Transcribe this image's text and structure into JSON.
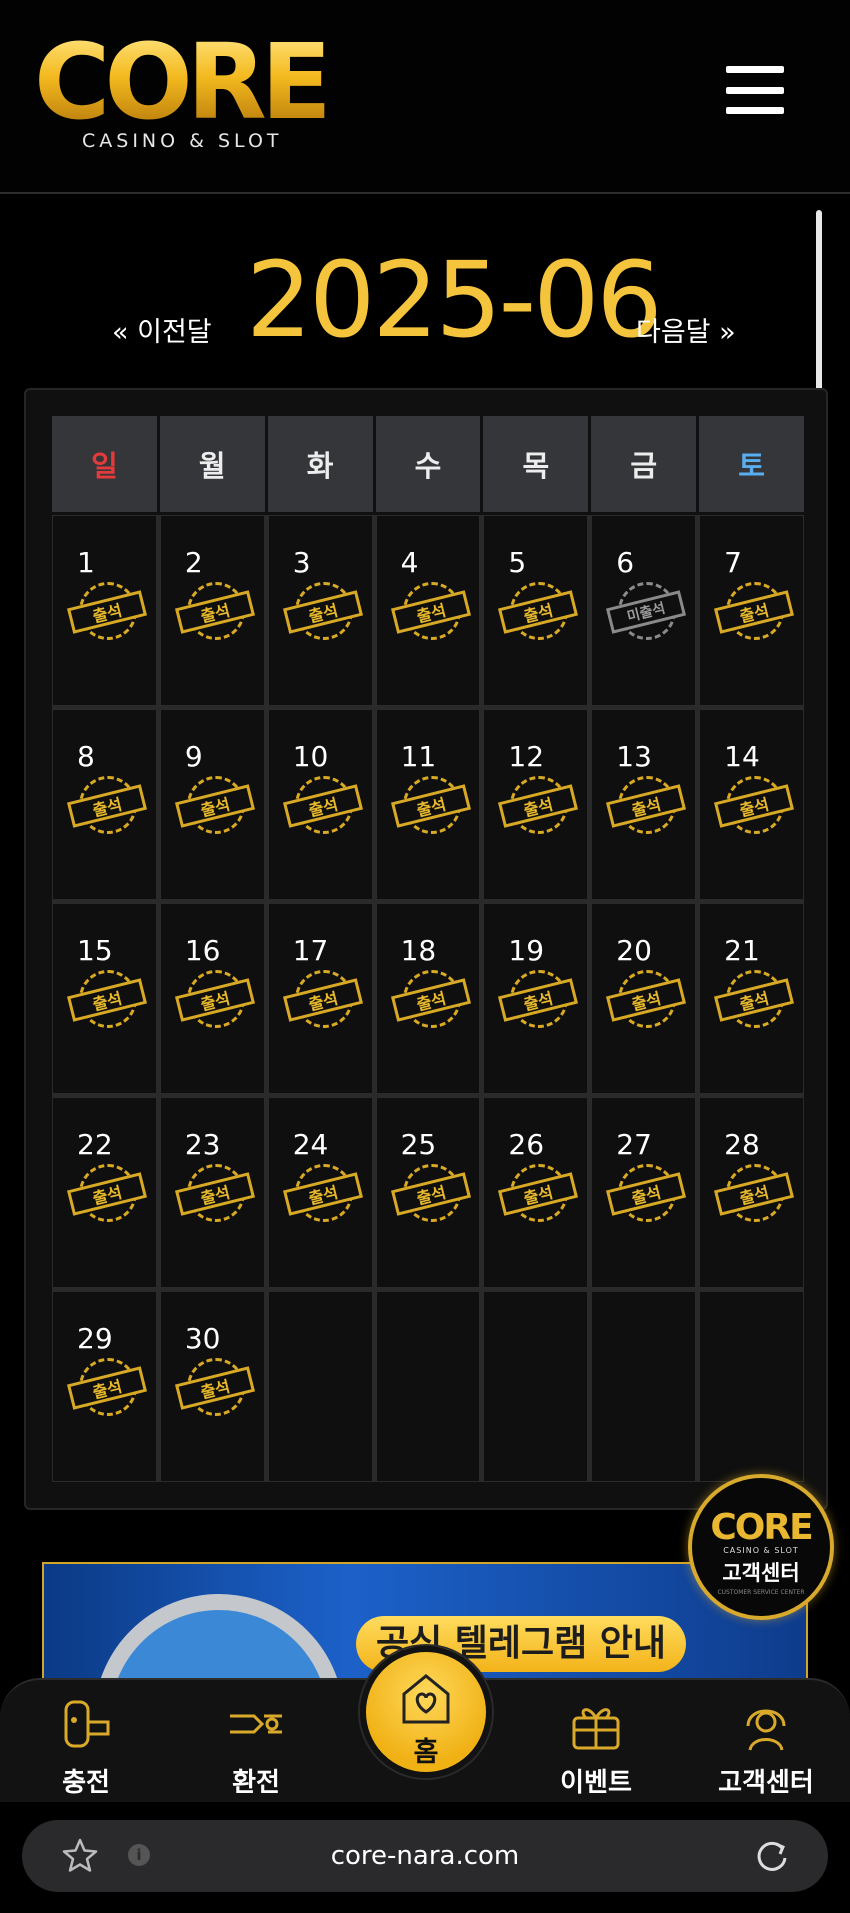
{
  "header": {
    "logo_text": "CORE",
    "logo_subtitle": "CASINO & SLOT",
    "menu_icon": "hamburger-menu-icon"
  },
  "month_nav": {
    "prev_label": "« 이전달",
    "title": "2025-06",
    "next_label": "다음달 »"
  },
  "calendar": {
    "weekdays": [
      {
        "label": "일",
        "color": "#e53a3a"
      },
      {
        "label": "월",
        "color": "#ededed"
      },
      {
        "label": "화",
        "color": "#ededed"
      },
      {
        "label": "수",
        "color": "#ededed"
      },
      {
        "label": "목",
        "color": "#ededed"
      },
      {
        "label": "금",
        "color": "#ededed"
      },
      {
        "label": "토",
        "color": "#5aaef0"
      }
    ],
    "stamp_attended": "출석",
    "stamp_missed": "미출석",
    "days": [
      {
        "day": "1",
        "status": "attended"
      },
      {
        "day": "2",
        "status": "attended"
      },
      {
        "day": "3",
        "status": "attended"
      },
      {
        "day": "4",
        "status": "attended"
      },
      {
        "day": "5",
        "status": "attended"
      },
      {
        "day": "6",
        "status": "missed"
      },
      {
        "day": "7",
        "status": "attended"
      },
      {
        "day": "8",
        "status": "attended"
      },
      {
        "day": "9",
        "status": "attended"
      },
      {
        "day": "10",
        "status": "attended"
      },
      {
        "day": "11",
        "status": "attended"
      },
      {
        "day": "12",
        "status": "attended"
      },
      {
        "day": "13",
        "status": "attended"
      },
      {
        "day": "14",
        "status": "attended"
      },
      {
        "day": "15",
        "status": "attended"
      },
      {
        "day": "16",
        "status": "attended"
      },
      {
        "day": "17",
        "status": "attended"
      },
      {
        "day": "18",
        "status": "attended"
      },
      {
        "day": "19",
        "status": "attended"
      },
      {
        "day": "20",
        "status": "attended"
      },
      {
        "day": "21",
        "status": "attended"
      },
      {
        "day": "22",
        "status": "attended"
      },
      {
        "day": "23",
        "status": "attended"
      },
      {
        "day": "24",
        "status": "attended"
      },
      {
        "day": "25",
        "status": "attended"
      },
      {
        "day": "26",
        "status": "attended"
      },
      {
        "day": "27",
        "status": "attended"
      },
      {
        "day": "28",
        "status": "attended"
      },
      {
        "day": "29",
        "status": "attended"
      },
      {
        "day": "30",
        "status": "attended"
      },
      {
        "day": "",
        "status": "empty"
      },
      {
        "day": "",
        "status": "empty"
      },
      {
        "day": "",
        "status": "empty"
      },
      {
        "day": "",
        "status": "empty"
      },
      {
        "day": "",
        "status": "empty"
      }
    ]
  },
  "cs_badge": {
    "logo": "CORE",
    "sub": "CASINO & SLOT",
    "label": "고객센터",
    "tiny": "CUSTOMER SERVICE CENTER"
  },
  "banner": {
    "title": "공식 텔레그램 안내"
  },
  "bottom_nav": {
    "items": [
      {
        "label": "충전",
        "icon": "deposit-icon"
      },
      {
        "label": "환전",
        "icon": "withdraw-icon"
      },
      {
        "label": "홈",
        "icon": "home-heart-icon"
      },
      {
        "label": "이벤트",
        "icon": "gift-icon"
      },
      {
        "label": "고객센터",
        "icon": "support-icon"
      }
    ]
  },
  "browser": {
    "url": "core-nara.com",
    "info": "i"
  },
  "colors": {
    "gold": "#f4c43c",
    "accent_blue": "#3b6ef0",
    "sunday": "#e53a3a",
    "saturday": "#5aaef0"
  }
}
